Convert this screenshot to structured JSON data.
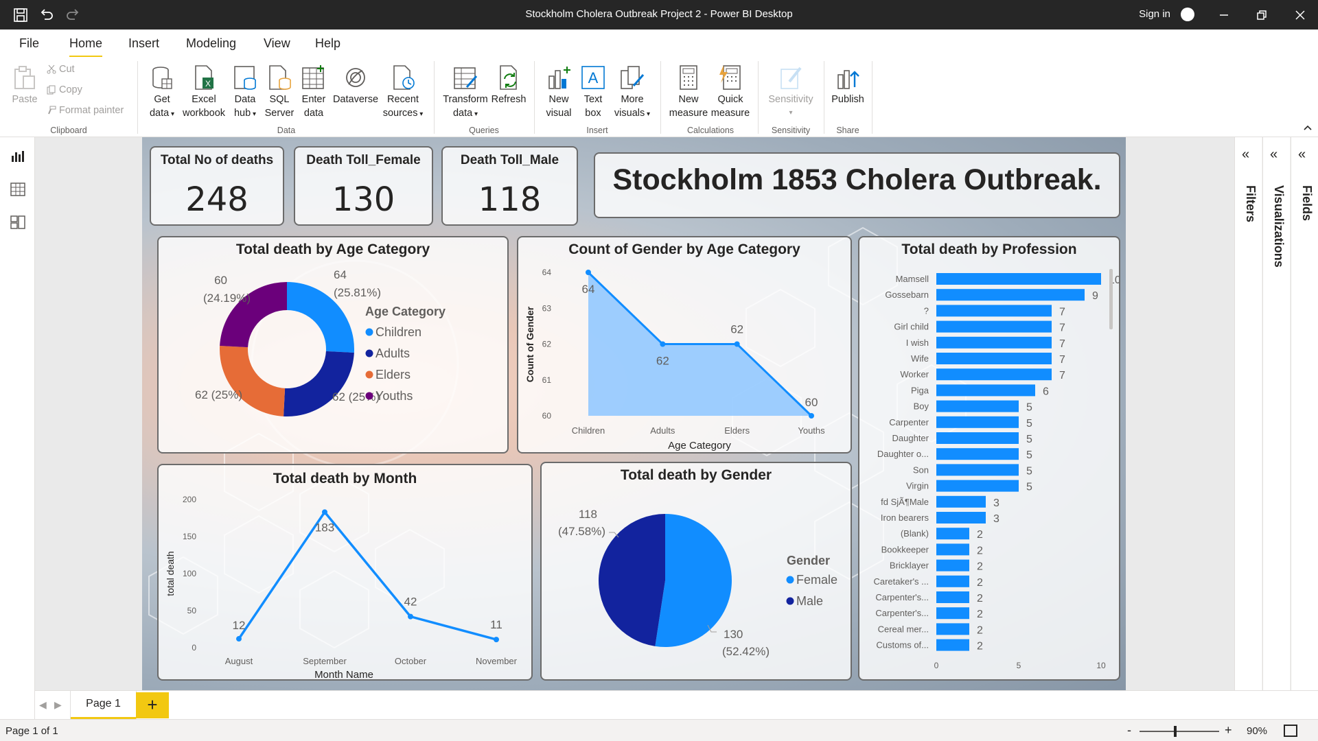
{
  "window": {
    "title": "Stockholm Cholera Outbreak Project 2 - Power BI Desktop",
    "sign_in": "Sign in"
  },
  "menu": {
    "tabs": [
      "File",
      "Home",
      "Insert",
      "Modeling",
      "View",
      "Help"
    ],
    "active": "Home"
  },
  "ribbon": {
    "clipboard": {
      "paste": "Paste",
      "cut": "Cut",
      "copy": "Copy",
      "format_painter": "Format painter",
      "label": "Clipboard"
    },
    "data": {
      "get_data": [
        "Get",
        "data"
      ],
      "excel": [
        "Excel",
        "workbook"
      ],
      "data_hub": [
        "Data",
        "hub"
      ],
      "sql": [
        "SQL",
        "Server"
      ],
      "enter_data": [
        "Enter",
        "data"
      ],
      "dataverse": "Dataverse",
      "recent": [
        "Recent",
        "sources"
      ],
      "label": "Data"
    },
    "queries": {
      "transform": [
        "Transform",
        "data"
      ],
      "refresh": "Refresh",
      "label": "Queries"
    },
    "insert": {
      "new_visual": [
        "New",
        "visual"
      ],
      "text_box": [
        "Text",
        "box"
      ],
      "more_visuals": [
        "More",
        "visuals"
      ],
      "label": "Insert"
    },
    "calculations": {
      "new_measure": [
        "New",
        "measure"
      ],
      "quick_measure": [
        "Quick",
        "measure"
      ],
      "label": "Calculations"
    },
    "sensitivity": {
      "sensitivity": "Sensitivity",
      "label": "Sensitivity"
    },
    "share": {
      "publish": "Publish",
      "label": "Share"
    }
  },
  "report": {
    "title": "Stockholm 1853 Cholera Outbreak.",
    "kpis": [
      {
        "label": "Total No of deaths",
        "value": "248"
      },
      {
        "label": "Death Toll_Female",
        "value": "130"
      },
      {
        "label": "Death Toll_Male",
        "value": "118"
      }
    ]
  },
  "chart_data": [
    {
      "type": "pie",
      "variant": "donut",
      "title": "Total death by Age Category",
      "legend_title": "Age Category",
      "legend_position": "right",
      "categories": [
        "Children",
        "Adults",
        "Elders",
        "Youths"
      ],
      "values": [
        64,
        62,
        62,
        60
      ],
      "labels": [
        "64 (25.81%)",
        "62 (25%)",
        "62 (25%)",
        "60 (24.19%)"
      ],
      "colors": [
        "#118dff",
        "#12239e",
        "#e66c37",
        "#6b007b"
      ]
    },
    {
      "type": "area",
      "title": "Count of Gender by Age Category",
      "categories": [
        "Children",
        "Adults",
        "Elders",
        "Youths"
      ],
      "values": [
        64,
        62,
        62,
        60
      ],
      "xlabel": "Age Category",
      "ylabel": "Count of Gender",
      "yticks": [
        60,
        61,
        62,
        63,
        64
      ],
      "ylim": [
        60,
        64
      ],
      "color": "#118dff"
    },
    {
      "type": "bar",
      "orientation": "horizontal",
      "title": "Total death by Profession",
      "categories": [
        "Mamsell",
        "Gossebarn",
        "?",
        "Girl child",
        "I wish",
        "Wife",
        "Worker",
        "Piga",
        "Boy",
        "Carpenter",
        "Daughter",
        "Daughter o...",
        "Son",
        "Virgin",
        "fd SjÃ¶Male",
        "Iron bearers",
        "(Blank)",
        "Bookkeeper",
        "Bricklayer",
        "Caretaker's ...",
        "Carpenter's...",
        "Carpenter's...",
        "Cereal mer...",
        "Customs of..."
      ],
      "values": [
        10,
        9,
        7,
        7,
        7,
        7,
        7,
        6,
        5,
        5,
        5,
        5,
        5,
        5,
        3,
        3,
        2,
        2,
        2,
        2,
        2,
        2,
        2,
        2
      ],
      "xticks": [
        0,
        5,
        10
      ],
      "xlim": [
        0,
        10
      ],
      "color": "#118dff"
    },
    {
      "type": "line",
      "title": "Total death by Month",
      "categories": [
        "August",
        "September",
        "October",
        "November"
      ],
      "values": [
        12,
        183,
        42,
        11
      ],
      "xlabel": "Month Name",
      "ylabel": "total death",
      "yticks": [
        0,
        50,
        100,
        150,
        200
      ],
      "ylim": [
        0,
        200
      ],
      "color": "#118dff"
    },
    {
      "type": "pie",
      "title": "Total death by Gender",
      "legend_title": "Gender",
      "legend_position": "right",
      "categories": [
        "Female",
        "Male"
      ],
      "values": [
        130,
        118
      ],
      "labels": [
        [
          "130",
          "(52.42%)"
        ],
        [
          "118",
          "(47.58%)"
        ]
      ],
      "colors": [
        "#118dff",
        "#12239e"
      ]
    }
  ],
  "side_panes": [
    "Filters",
    "Visualizations",
    "Fields"
  ],
  "pages": {
    "tabs": [
      "Page 1"
    ],
    "status": "Page 1 of 1"
  },
  "zoom": "90%"
}
